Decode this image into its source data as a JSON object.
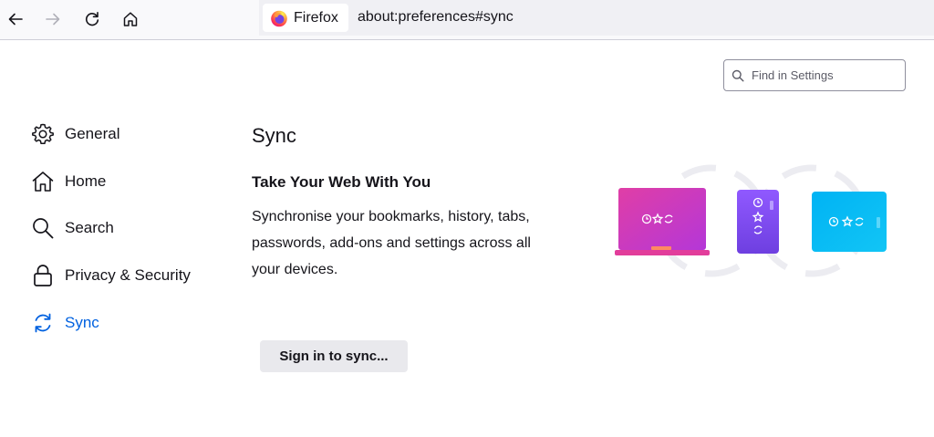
{
  "toolbar": {
    "back_icon": "back-arrow-icon",
    "forward_icon": "forward-arrow-icon",
    "reload_icon": "reload-icon",
    "home_icon": "home-icon",
    "identity_label": "Firefox",
    "url": "about:preferences#sync"
  },
  "search": {
    "placeholder": "Find in Settings"
  },
  "sidebar": {
    "items": [
      {
        "label": "General",
        "icon": "gear-icon"
      },
      {
        "label": "Home",
        "icon": "home-icon"
      },
      {
        "label": "Search",
        "icon": "search-icon"
      },
      {
        "label": "Privacy & Security",
        "icon": "lock-icon"
      },
      {
        "label": "Sync",
        "icon": "sync-icon",
        "selected": true
      }
    ]
  },
  "main": {
    "title": "Sync",
    "heading": "Take Your Web With You",
    "description": "Synchronise your bookmarks, history, tabs, passwords, add-ons and settings across all your devices.",
    "sign_in_label": "Sign in to sync..."
  },
  "colors": {
    "accent": "#0061e0",
    "laptop_gradient": [
      "#e03ea6",
      "#a23ce0"
    ],
    "phone_gradient": [
      "#9059ff",
      "#6a3ce0"
    ],
    "tablet_gradient": [
      "#00b3f4",
      "#0dc2f0"
    ]
  }
}
